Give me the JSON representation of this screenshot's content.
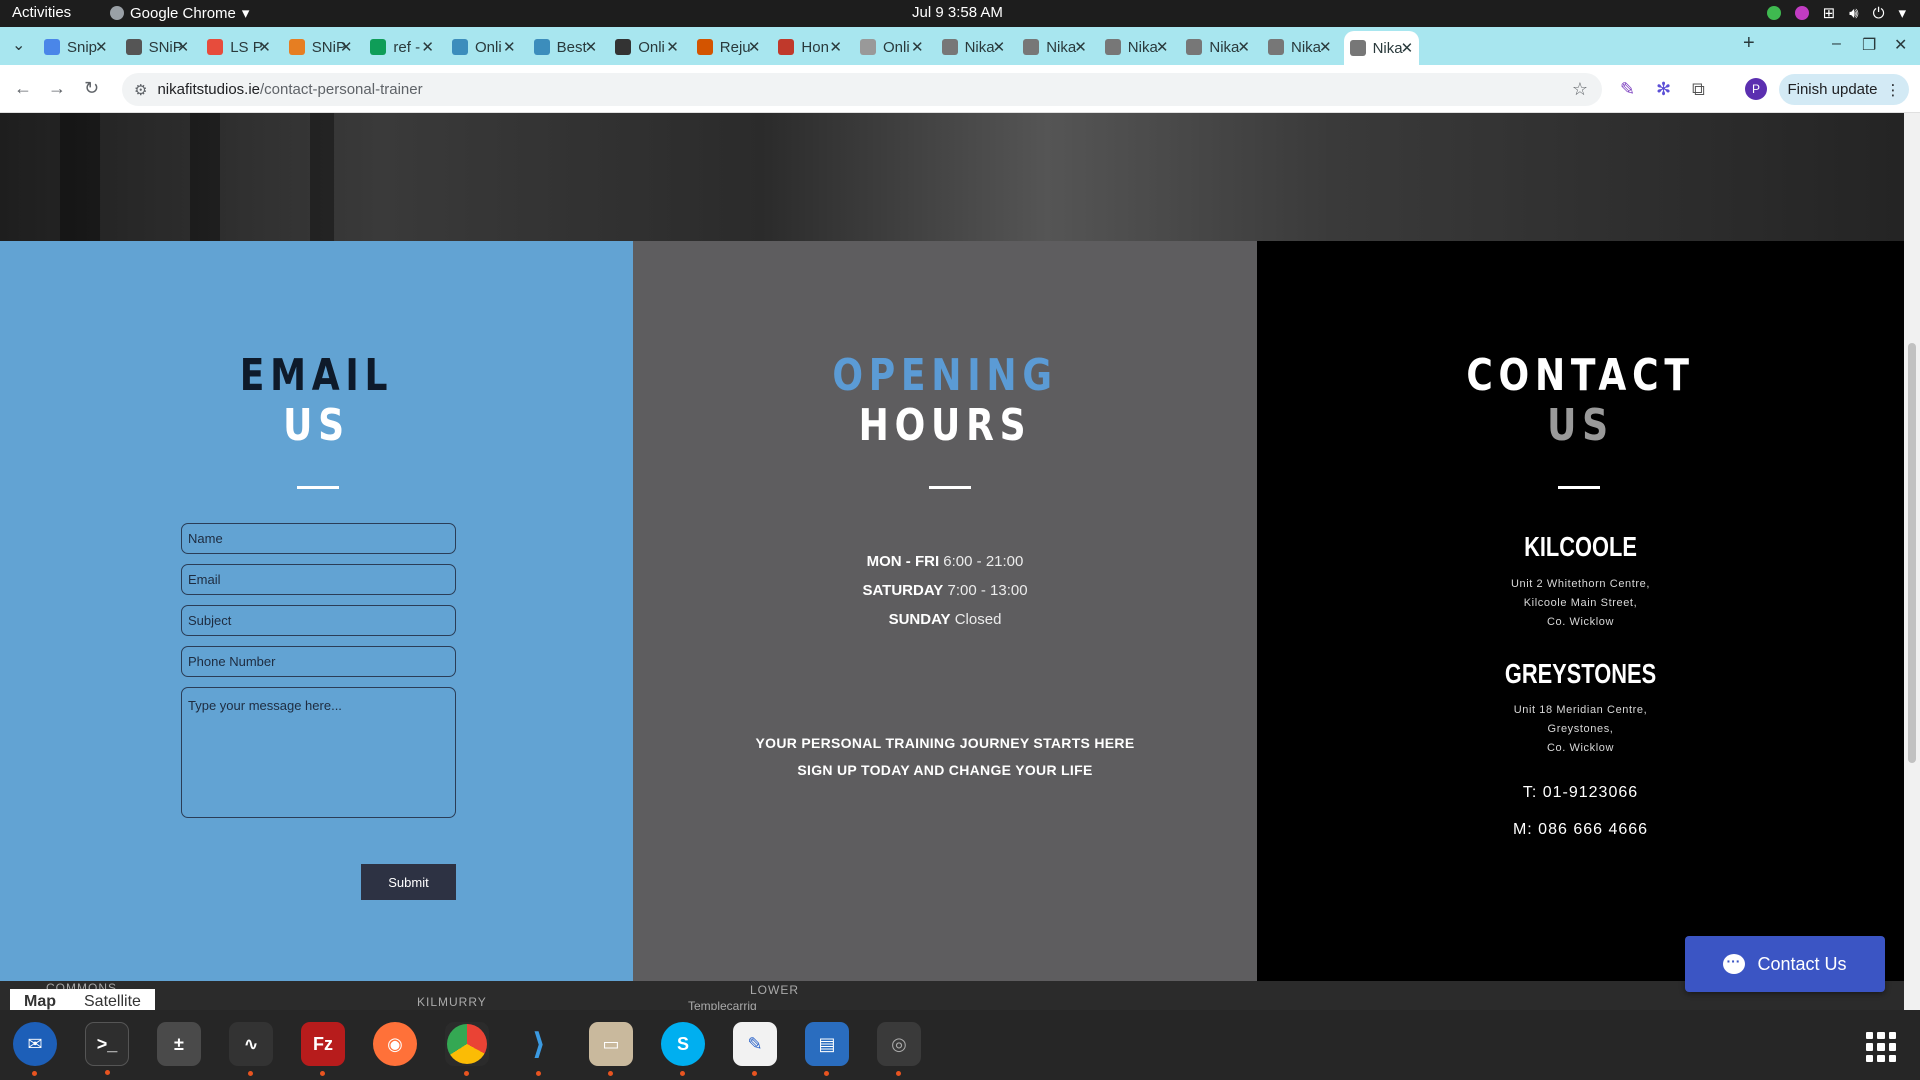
{
  "system": {
    "activities": "Activities",
    "app_name": "Google Chrome",
    "clock": "Jul 9  3:58 AM"
  },
  "tabs": [
    {
      "label": "Snip",
      "color": "#4a86e8"
    },
    {
      "label": "SNiP",
      "color": "#555555"
    },
    {
      "label": "LS P",
      "color": "#e74c3c"
    },
    {
      "label": "SNiP",
      "color": "#e67e22"
    },
    {
      "label": "ref -",
      "color": "#0f9d58"
    },
    {
      "label": "Onli",
      "color": "#3c8dbc"
    },
    {
      "label": "Best",
      "color": "#3c8dbc"
    },
    {
      "label": "Onli",
      "color": "#333333"
    },
    {
      "label": "Reju",
      "color": "#d35400"
    },
    {
      "label": "Hon",
      "color": "#c0392b"
    },
    {
      "label": "Onli",
      "color": "#999999"
    },
    {
      "label": "Nika",
      "color": "#777777"
    },
    {
      "label": "Nika",
      "color": "#777777"
    },
    {
      "label": "Nika",
      "color": "#777777"
    },
    {
      "label": "Nika",
      "color": "#777777"
    },
    {
      "label": "Nika",
      "color": "#777777"
    },
    {
      "label": "Nika",
      "color": "#777777"
    }
  ],
  "toolbar": {
    "url_host": "nikafitstudios.ie",
    "url_path": "/contact-personal-trainer",
    "profile_initial": "P",
    "finish_update": "Finish update"
  },
  "email": {
    "title_line1": "EMAIL",
    "title_line2": "US",
    "name_placeholder": "Name",
    "email_placeholder": "Email",
    "subject_placeholder": "Subject",
    "phone_placeholder": "Phone Number",
    "message_placeholder": "Type your message here...",
    "submit": "Submit"
  },
  "hours": {
    "title_line1": "OPENING",
    "title_line2": "HOURS",
    "rows": [
      {
        "day": "MON - FRI",
        "time": "6:00 - 21:00"
      },
      {
        "day": "SATURDAY",
        "time": "7:00 - 13:00"
      },
      {
        "day": "SUNDAY",
        "time": "Closed"
      }
    ],
    "promo_line1": "YOUR PERSONAL TRAINING JOURNEY STARTS HERE",
    "promo_line2": "SIGN UP TODAY AND CHANGE YOUR LIFE"
  },
  "contact": {
    "title_line1": "CONTACT",
    "title_line2": "US",
    "locations": [
      {
        "name": "KILCOOLE",
        "lines": [
          "Unit 2 Whitethorn Centre,",
          "Kilcoole Main Street,",
          "Co. Wicklow"
        ]
      },
      {
        "name": "GREYSTONES",
        "lines": [
          "Unit 18 Meridian Centre,",
          "Greystones,",
          "Co. Wicklow"
        ]
      }
    ],
    "telephone": "T: 01-9123066",
    "mobile": "M: 086 666 4666"
  },
  "map": {
    "tab_map": "Map",
    "tab_satellite": "Satellite",
    "places": [
      "COMMONS",
      "KILMURRY",
      "LOWER",
      "Templecarrig"
    ]
  },
  "widget": {
    "contact_us": "Contact Us"
  },
  "colors": {
    "email_panel": "#62a3d3",
    "hours_panel": "#5e5d5f",
    "contact_panel": "#000000",
    "accent_blue": "#5b9bd5",
    "submit_bg": "#2d3243",
    "widget_bg": "#3b55c4"
  }
}
